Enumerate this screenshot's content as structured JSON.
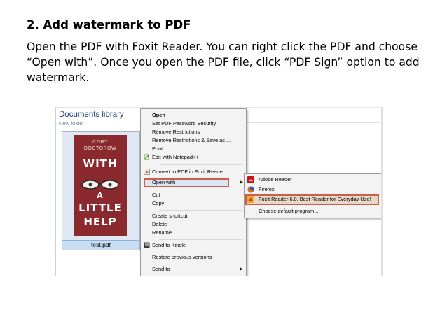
{
  "slide": {
    "title": "2. Add watermark to PDF",
    "body": "Open the PDF with Foxit Reader. You can right click the PDF and choose “Open with”. Once you open the PDF file, click “PDF Sign” option to add watermark."
  },
  "explorer": {
    "library_title": "Documents library",
    "library_subtitle": "New folder",
    "file_name": "test.pdf"
  },
  "cover": {
    "author_first": "CORY",
    "author_last": "DOCTOROW",
    "line1": "WITH",
    "line2": "A",
    "line3": "LITTLE",
    "line4": "HELP"
  },
  "context_menu": {
    "items": [
      "Open",
      "Set PDF Password Security",
      "Remove Restrictions",
      "Remove Restrictions & Save as ...",
      "Print",
      "Edit with Notepad++",
      "Convert to PDF in Foxit Reader",
      "Open with",
      "Cut",
      "Copy",
      "Create shortcut",
      "Delete",
      "Rename",
      "Send to Kindle",
      "Restore previous versions",
      "Send to"
    ],
    "icons": {
      "notepad": "notepad-icon",
      "foxit_convert": "foxit-icon",
      "kindle": "kindle-icon"
    }
  },
  "submenu": {
    "items": [
      "Adobe Reader",
      "Firefox",
      "Foxit Reader 6.0, Best Reader for Everyday Use!",
      "Choose default program..."
    ],
    "icons": [
      "adobe-reader-icon",
      "firefox-icon",
      "foxit-reader-icon",
      ""
    ]
  },
  "colors": {
    "highlight_border": "#c9604a",
    "library_title": "#1e3f7a",
    "cover_bg": "#8a2a2e"
  }
}
